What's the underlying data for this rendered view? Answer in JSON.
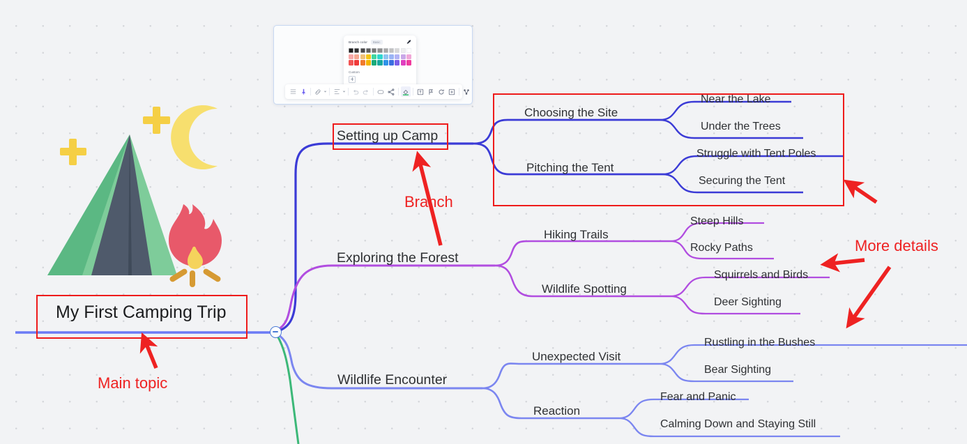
{
  "canvas": {
    "background_color": "#f2f3f5",
    "dot_color": "#d5d7db"
  },
  "mindmap": {
    "root": {
      "label": "My First Camping Trip",
      "branch_color": "#6b7bf5"
    },
    "branches": [
      {
        "label": "Setting up Camp",
        "color": "#3b3bd6",
        "children": [
          {
            "label": "Choosing the Site",
            "children": [
              {
                "label": "Near the Lake"
              },
              {
                "label": "Under the Trees"
              }
            ]
          },
          {
            "label": "Pitching the Tent",
            "children": [
              {
                "label": "Struggle with Tent Poles"
              },
              {
                "label": "Securing the Tent"
              }
            ]
          }
        ]
      },
      {
        "label": "Exploring the Forest",
        "color": "#b14de0",
        "children": [
          {
            "label": "Hiking Trails",
            "children": [
              {
                "label": "Steep Hills"
              },
              {
                "label": "Rocky Paths"
              }
            ]
          },
          {
            "label": "Wildlife Spotting",
            "children": [
              {
                "label": "Squirrels and Birds"
              },
              {
                "label": "Deer Sighting"
              }
            ]
          }
        ]
      },
      {
        "label": "Wildlife Encounter",
        "color": "#7b86f0",
        "children": [
          {
            "label": "Unexpected Visit",
            "children": [
              {
                "label": "Rustling in the Bushes"
              },
              {
                "label": "Bear Sighting"
              }
            ]
          },
          {
            "label": "Reaction",
            "children": [
              {
                "label": "Fear and Panic"
              },
              {
                "label": "Calming Down and Staying Still"
              }
            ]
          }
        ]
      },
      {
        "label": "",
        "color": "#3cb878",
        "children": []
      }
    ],
    "collapse_button": {
      "state": "expanded",
      "glyph": "minus"
    }
  },
  "annotations": {
    "color": "#ee2222",
    "labels": [
      {
        "text": "Main topic"
      },
      {
        "text": "Branch"
      },
      {
        "text": "More details"
      }
    ]
  },
  "color_panel": {
    "title": "Branch color",
    "tab": "Basic",
    "custom_label": "Custom",
    "rows": [
      [
        "#1b1b1b",
        "#2f2f2f",
        "#474747",
        "#5e5e5e",
        "#767676",
        "#8f8f8f",
        "#a8a8a8",
        "#c1c1c1",
        "#d8d8d8",
        "#eeeeee",
        "#ffffff"
      ],
      [
        "#f7a8a8",
        "#f5a893",
        "#f0c178",
        "#f5c518",
        "#3fd6a0",
        "#2fd6cf",
        "#8fc4f0",
        "#9ab4f5",
        "#b1b3f5",
        "#c9a8e8",
        "#f0a8d8"
      ],
      [
        "#f25555",
        "#f03b3b",
        "#f07a2e",
        "#f5b400",
        "#1aab7a",
        "#18a89e",
        "#2f93e8",
        "#3b6fe0",
        "#7c5fe8",
        "#e040c0",
        "#f03b9e"
      ]
    ]
  },
  "mini_toolbar": {
    "buttons": [
      "list-icon",
      "pin-icon",
      "link-icon",
      "chevron-down-icon",
      "align-icon",
      "chevron-down-icon",
      "undo-icon",
      "redo-icon",
      "shape-icon",
      "connector-icon",
      "branch-color-icon",
      "image-icon",
      "flag-icon",
      "refresh-icon",
      "add-frame-icon",
      "relation-icon",
      "theme-icon",
      "more-icon"
    ],
    "active_button": "branch-color-icon",
    "more_glyph": "···"
  },
  "illustration": {
    "name": "camping-tent-campfire-moon",
    "colors": {
      "tent_light": "#7ecc9a",
      "tent_mid": "#5bb883",
      "tent_dark": "#4f5a6b",
      "fire": "#e8596a",
      "fire_core": "#f5d35c",
      "logs": "#d69a33",
      "moon": "#f7df6e",
      "sparkle": "#f5cf45"
    }
  }
}
